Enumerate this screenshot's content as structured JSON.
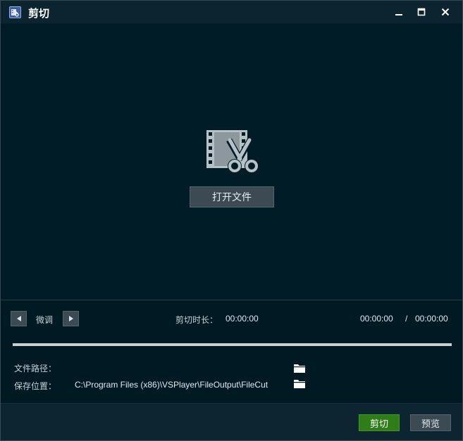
{
  "window": {
    "title": "剪切",
    "icons": {
      "app": "app-logo-icon",
      "minimize": "minimize-icon",
      "maximize": "maximize-icon",
      "close": "close-icon"
    }
  },
  "preview": {
    "icon": "film-scissors-icon",
    "open_file_label": "打开文件"
  },
  "controls": {
    "fine_tune_label": "微调",
    "prev_icon": "triangle-left-icon",
    "next_icon": "triangle-right-icon",
    "cut_duration_label": "剪切时长：",
    "cut_duration_value": "00:00:00",
    "current_time": "00:00:00",
    "time_separator": "/",
    "total_time": "00:00:00",
    "progress": 1.0
  },
  "paths": {
    "file_path_label": "文件路径：",
    "file_path_value": "",
    "save_location_label": "保存位置：",
    "save_location_value": "C:\\Program Files (x86)\\VSPlayer\\FileOutput\\FileCut",
    "folder_icon": "folder-icon"
  },
  "footer": {
    "cut_label": "剪切",
    "preview_label": "预览"
  },
  "colors": {
    "background": "#001c26",
    "titlebar": "#0c2430",
    "button": "#3b4a53",
    "accent_green": "#2e7d18"
  }
}
